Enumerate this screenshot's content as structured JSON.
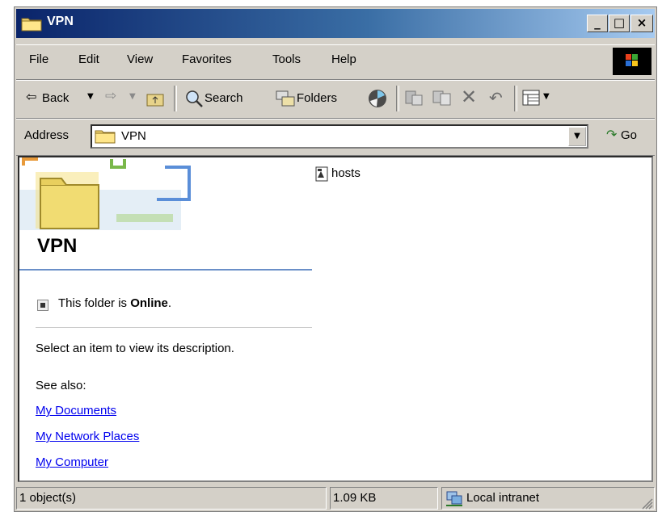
{
  "window": {
    "title": "VPN"
  },
  "titlebar_buttons": {
    "minimize": "_",
    "maximize": "□",
    "close": "×"
  },
  "menu": {
    "items": [
      "File",
      "Edit",
      "View",
      "Favorites",
      "Tools",
      "Help"
    ]
  },
  "toolbar": {
    "back": "Back",
    "search": "Search",
    "folders": "Folders"
  },
  "address": {
    "label": "Address",
    "value": "VPN",
    "go": "Go"
  },
  "sidebar": {
    "folder_title": "VPN",
    "online_prefix": "This folder is ",
    "online_status": "Online",
    "online_suffix": ".",
    "description": "Select an item to view its description.",
    "see_also": "See also:",
    "links": [
      "My Documents",
      "My Network Places",
      "My Computer"
    ]
  },
  "files": [
    {
      "name": "hosts",
      "icon": "text-file-icon"
    }
  ],
  "status": {
    "count": "1 object(s)",
    "size": "1.09 KB",
    "zone": "Local intranet"
  },
  "colors": {
    "titlebar_start": "#0a246a",
    "titlebar_end": "#a6caf0",
    "chrome": "#d4d0c8",
    "link": "#0000ee",
    "divider": "#6a8fc8"
  }
}
